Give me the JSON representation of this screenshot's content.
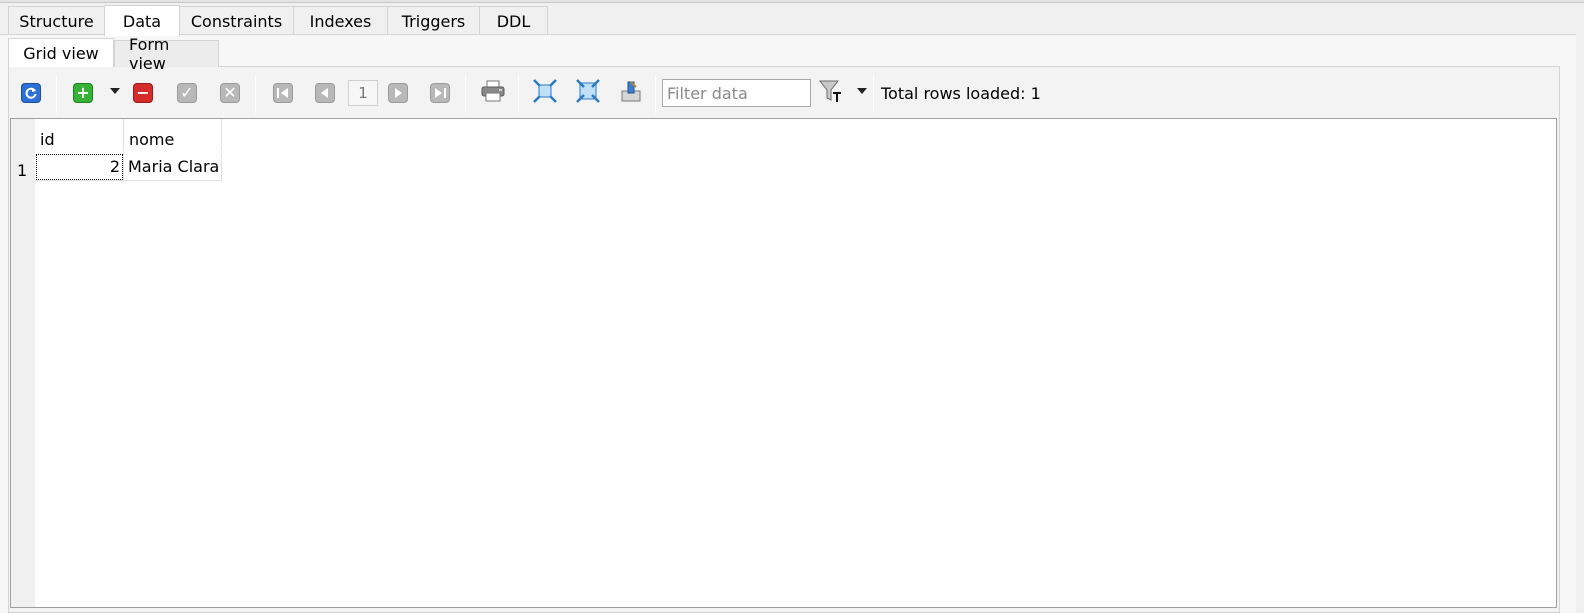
{
  "outer_tabs": [
    "Structure",
    "Data",
    "Constraints",
    "Indexes",
    "Triggers",
    "DDL"
  ],
  "active_outer_tab": "Data",
  "inner_tabs": [
    "Grid view",
    "Form view"
  ],
  "active_inner_tab": "Grid view",
  "toolbar": {
    "page_number": "1",
    "filter_placeholder": "Filter data",
    "rows_loaded": "Total rows loaded: 1"
  },
  "grid": {
    "columns": [
      "id",
      "nome"
    ],
    "rows": [
      {
        "num": "1",
        "cells": [
          "2",
          "Maria Clara"
        ]
      }
    ]
  },
  "icons": [
    "refresh-icon",
    "add-row-icon",
    "delete-row-icon",
    "commit-icon",
    "rollback-icon",
    "first-page-icon",
    "prev-page-icon",
    "next-page-icon",
    "last-page-icon",
    "print-icon",
    "expand-columns-icon",
    "collapse-columns-icon",
    "export-icon",
    "filter-funnel-icon"
  ]
}
